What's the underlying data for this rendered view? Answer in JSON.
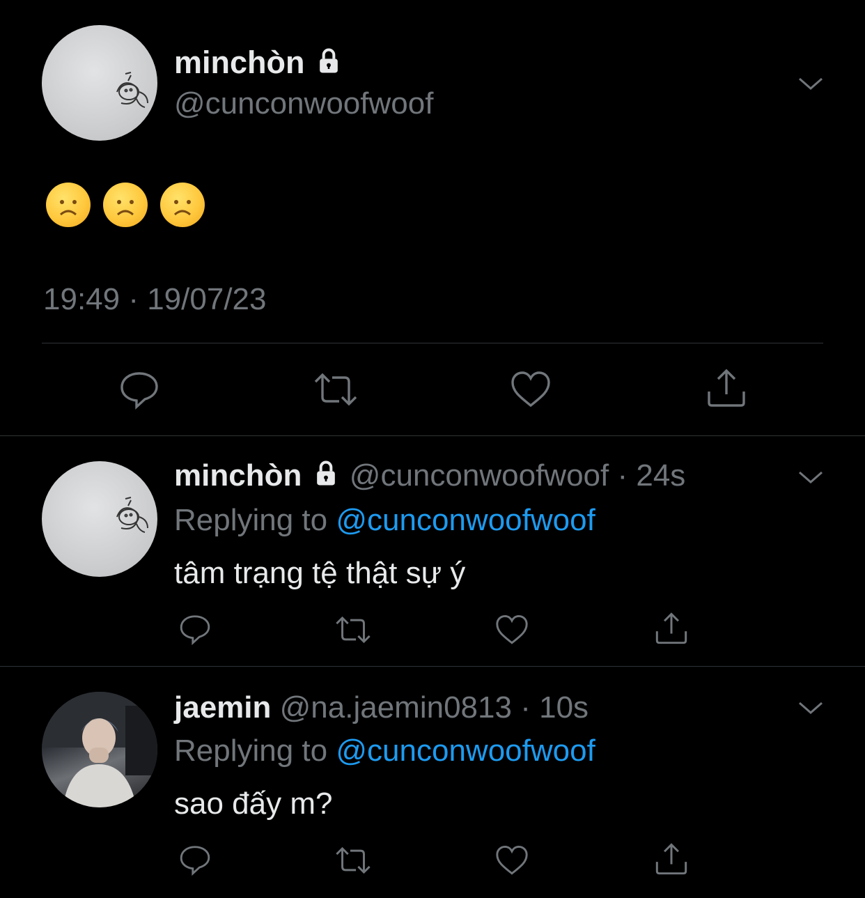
{
  "main_tweet": {
    "display_name": "minchòn",
    "handle": "@cunconwoofwoof",
    "content_emoji": "☹️☹️☹️",
    "timestamp": "19:49 · 19/07/23",
    "avatar_icon": "doodle-puppy-avatar",
    "actions": [
      "reply-icon",
      "retweet-icon",
      "like-icon",
      "share-icon"
    ]
  },
  "replies": [
    {
      "display_name": "minchòn",
      "handle": "@cunconwoofwoof",
      "separator": "·",
      "time_ago": "24s",
      "replying_prefix": "Replying to",
      "replying_to": "@cunconwoofwoof",
      "text": "tâm trạng tệ thật sự ý"
    },
    {
      "display_name": "jaemin",
      "handle": "@na.jaemin0813",
      "separator": "·",
      "time_ago": "10s",
      "replying_prefix": "Replying to",
      "replying_to": "@cunconwoofwoof",
      "text": "sao đấy m?"
    }
  ],
  "colors": {
    "background": "#000000",
    "text": "#e7e9ea",
    "muted": "#71767b",
    "link": "#1d9bf0",
    "divider": "#2f3336"
  }
}
